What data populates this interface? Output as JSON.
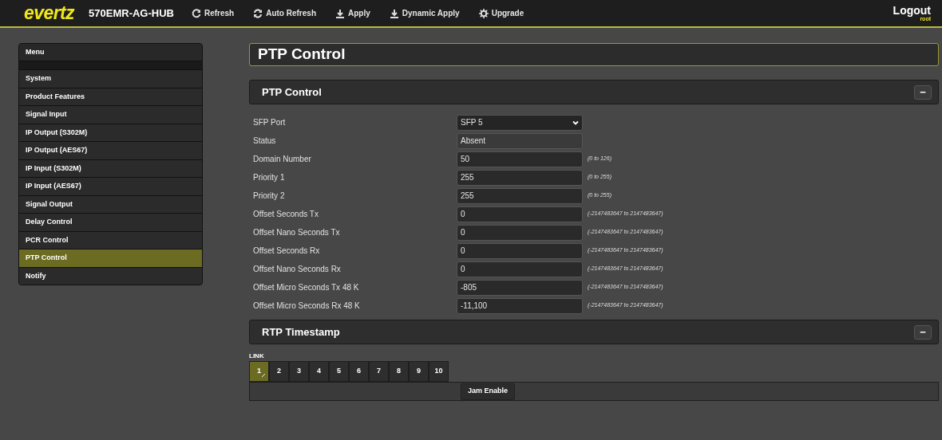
{
  "header": {
    "logo": "evertz",
    "device": "570EMR-AG-HUB",
    "actions": [
      {
        "label": "Refresh",
        "kind": "refresh"
      },
      {
        "label": "Auto Refresh",
        "kind": "cycle"
      },
      {
        "label": "Apply",
        "kind": "download"
      },
      {
        "label": "Dynamic Apply",
        "kind": "download"
      },
      {
        "label": "Upgrade",
        "kind": "gear"
      }
    ],
    "logout": "Logout",
    "user": "root"
  },
  "sidebar": {
    "title": "Menu",
    "items": [
      {
        "label": "System",
        "selected": false
      },
      {
        "label": "Product Features",
        "selected": false
      },
      {
        "label": "Signal Input",
        "selected": false
      },
      {
        "label": "IP Output (S302M)",
        "selected": false
      },
      {
        "label": "IP Output (AES67)",
        "selected": false
      },
      {
        "label": "IP Input (S302M)",
        "selected": false
      },
      {
        "label": "IP Input (AES67)",
        "selected": false
      },
      {
        "label": "Signal Output",
        "selected": false
      },
      {
        "label": "Delay Control",
        "selected": false
      },
      {
        "label": "PCR Control",
        "selected": false
      },
      {
        "label": "PTP Control",
        "selected": true
      },
      {
        "label": "Notify",
        "selected": false
      }
    ]
  },
  "page_title": "PTP Control",
  "ptp_section": {
    "title": "PTP Control",
    "collapse": "−",
    "fields": [
      {
        "label": "SFP Port",
        "kind": "select",
        "value": "SFP 5"
      },
      {
        "label": "Status",
        "kind": "readonly",
        "value": "Absent"
      },
      {
        "label": "Domain Number",
        "kind": "input",
        "value": "50",
        "hint": "(0 to 126)"
      },
      {
        "label": "Priority 1",
        "kind": "input",
        "value": "255",
        "hint": "(0 to 255)"
      },
      {
        "label": "Priority 2",
        "kind": "input",
        "value": "255",
        "hint": "(0 to 255)"
      },
      {
        "label": "Offset Seconds Tx",
        "kind": "input",
        "value": "0",
        "hint": "(-2147483647 to 2147483647)"
      },
      {
        "label": "Offset Nano Seconds Tx",
        "kind": "input",
        "value": "0",
        "hint": "(-2147483647 to 2147483647)"
      },
      {
        "label": "Offset Seconds Rx",
        "kind": "input",
        "value": "0",
        "hint": "(-2147483647 to 2147483647)"
      },
      {
        "label": "Offset Nano Seconds Rx",
        "kind": "input",
        "value": "0",
        "hint": "(-2147483647 to 2147483647)"
      },
      {
        "label": "Offset Micro Seconds Tx 48 K",
        "kind": "input",
        "value": "-805",
        "hint": "(-2147483647 to 2147483647)"
      },
      {
        "label": "Offset Micro Seconds Rx 48 K",
        "kind": "input",
        "value": "-11,100",
        "hint": "(-2147483647 to 2147483647)"
      }
    ]
  },
  "rtp_section": {
    "title": "RTP Timestamp",
    "collapse": "−",
    "link_label": "LINK",
    "links": [
      {
        "label": "1",
        "selected": true
      },
      {
        "label": "2",
        "selected": false
      },
      {
        "label": "3",
        "selected": false
      },
      {
        "label": "4",
        "selected": false
      },
      {
        "label": "5",
        "selected": false
      },
      {
        "label": "6",
        "selected": false
      },
      {
        "label": "7",
        "selected": false
      },
      {
        "label": "8",
        "selected": false
      },
      {
        "label": "9",
        "selected": false
      },
      {
        "label": "10",
        "selected": false
      }
    ],
    "button": "Jam Enable"
  }
}
